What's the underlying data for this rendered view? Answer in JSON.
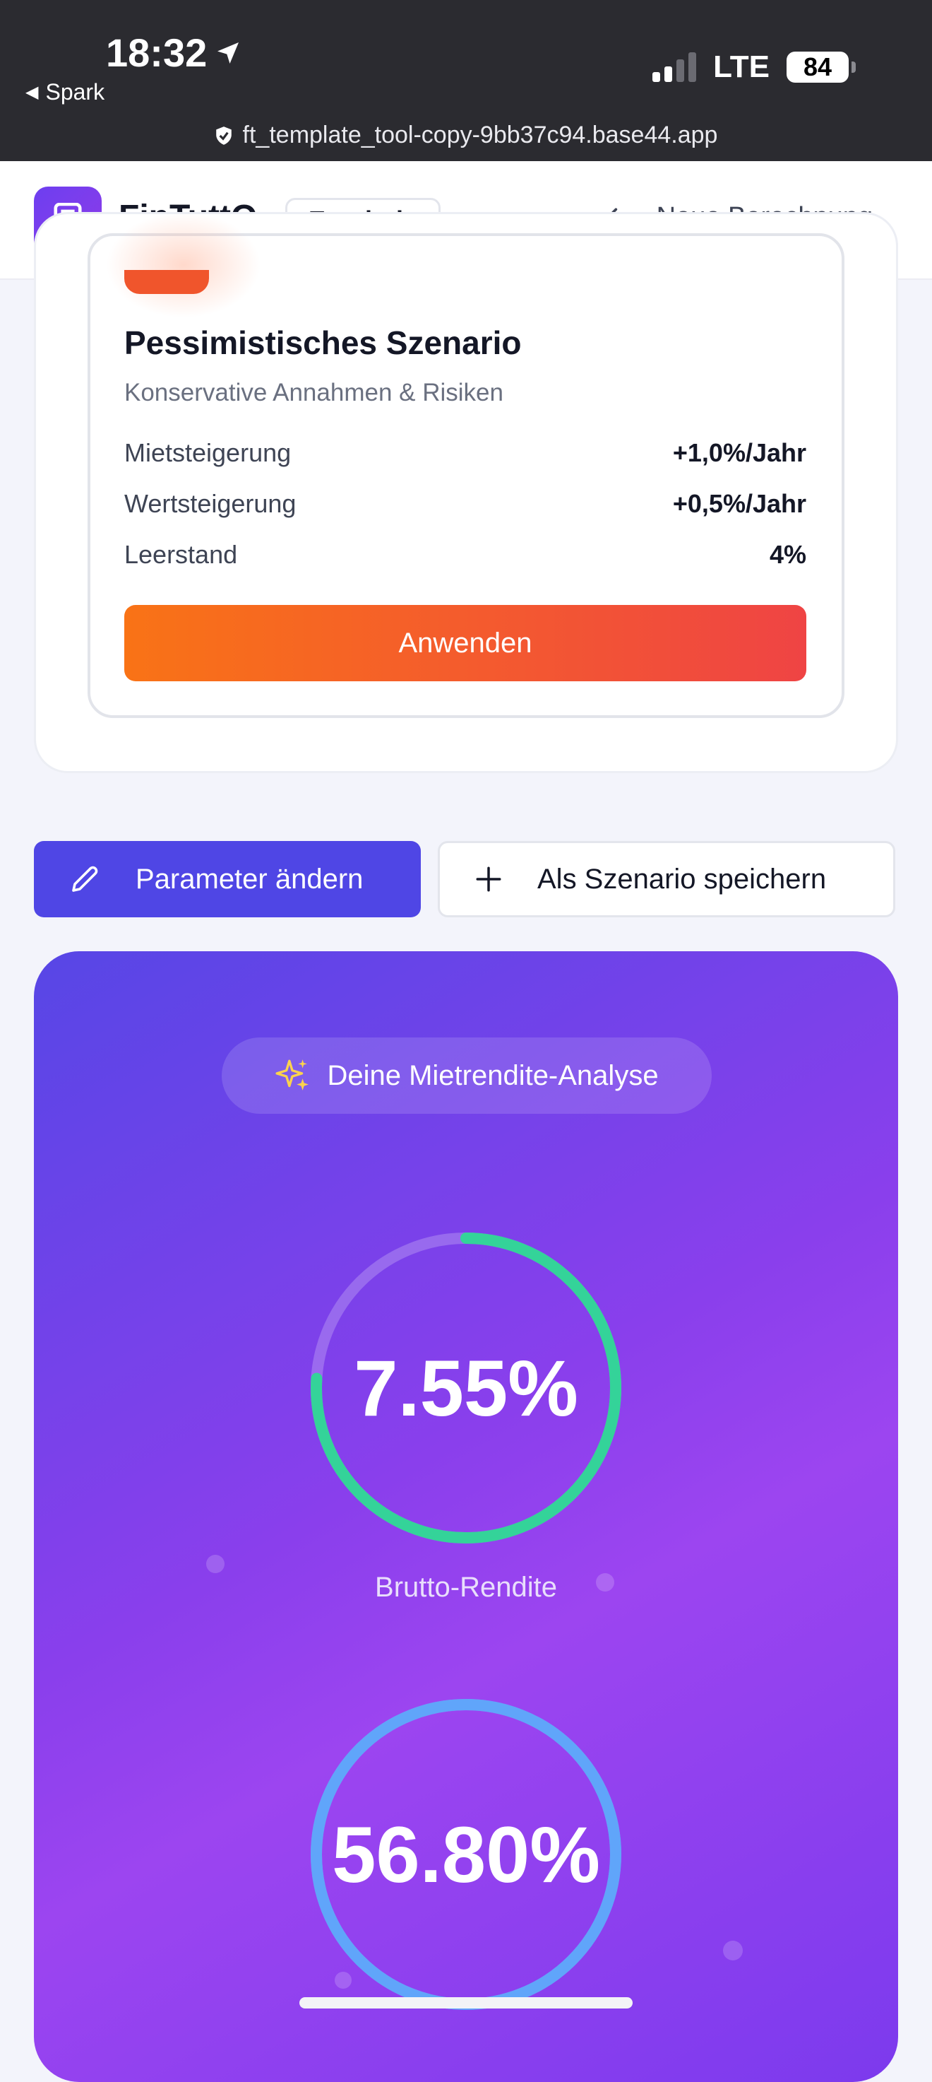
{
  "status_bar": {
    "time": "18:32",
    "back_app": "Spark",
    "network": "LTE",
    "battery": "84",
    "url": "ft_template_tool-copy-9bb37c94.base44.app"
  },
  "header": {
    "app_name": "FinTuttO",
    "badge": "Ergebnis",
    "new_calc_label": "Neue Berechnung"
  },
  "scenario": {
    "title": "Pessimistisches Szenario",
    "subtitle": "Konservative Annahmen & Risiken",
    "params": [
      {
        "label": "Mietsteigerung",
        "value": "+1,0%/Jahr"
      },
      {
        "label": "Wertsteigerung",
        "value": "+0,5%/Jahr"
      },
      {
        "label": "Leerstand",
        "value": "4%"
      }
    ],
    "apply_label": "Anwenden"
  },
  "actions": {
    "edit_label": "Parameter ändern",
    "save_label": "Als Szenario speichern"
  },
  "analysis": {
    "pill_label": "Deine Mietrendite-Analyse",
    "metrics": [
      {
        "value": "7.55%",
        "label": "Brutto-Rendite",
        "progress": 0.76,
        "color": "#34d399"
      },
      {
        "value": "56.80%",
        "label": "",
        "progress": 1.0,
        "color": "#60a5fa"
      }
    ]
  },
  "colors": {
    "primary": "#4f46e5",
    "apply_gradient_start": "#f97316",
    "apply_gradient_end": "#ef4444"
  }
}
